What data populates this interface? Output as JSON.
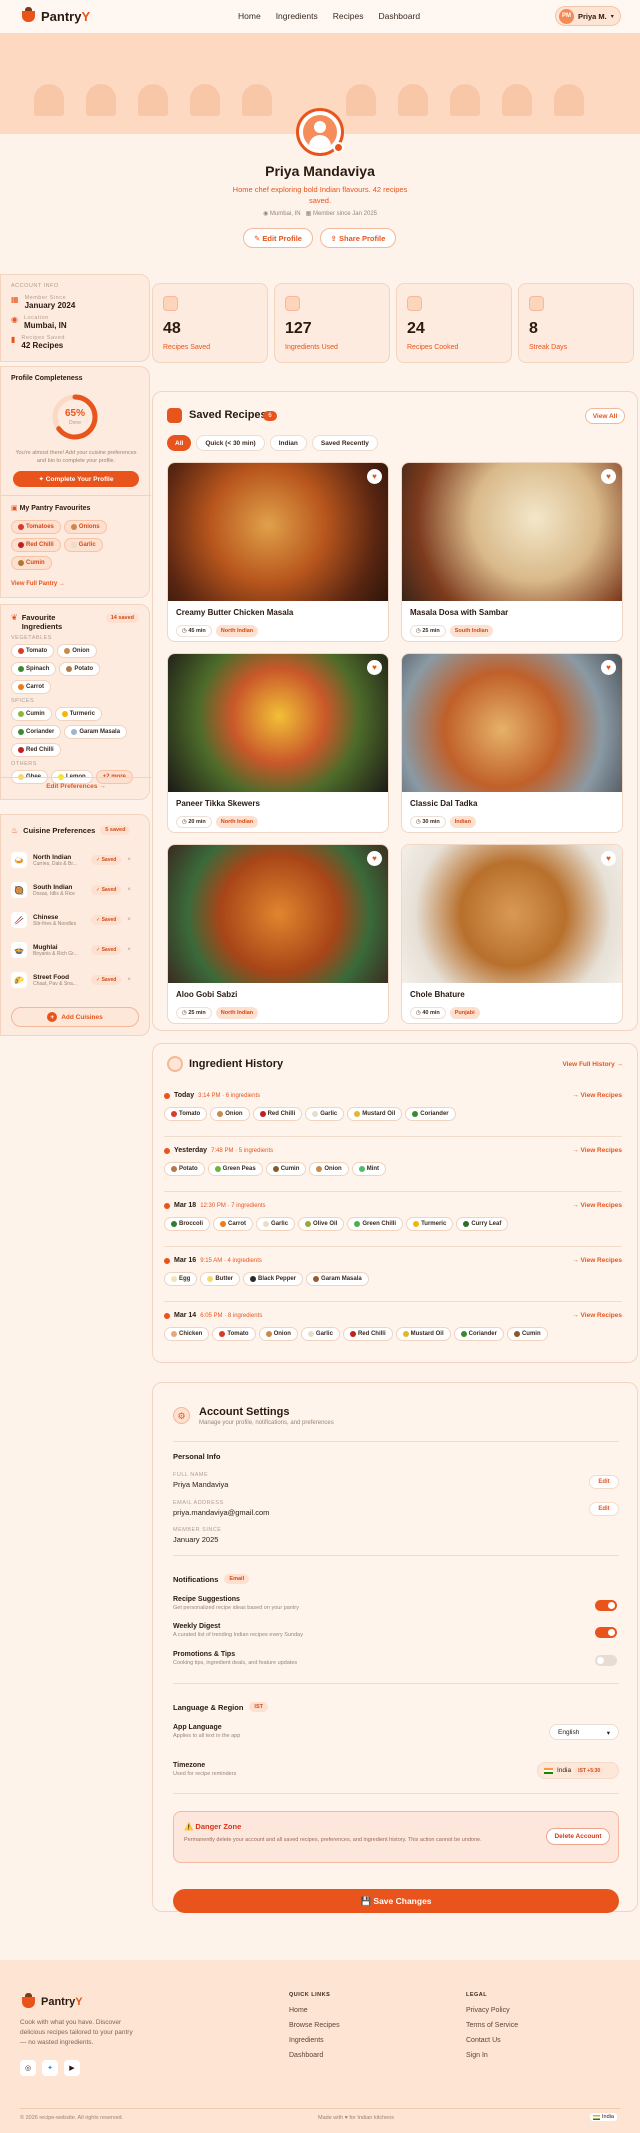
{
  "nav": {
    "brand": "Pantry",
    "brand_accent": "Y",
    "links": [
      "Home",
      "Ingredients",
      "Recipes",
      "Dashboard"
    ],
    "user_initials": "PM",
    "user_name": "Priya M."
  },
  "profile": {
    "name": "Priya Mandaviya",
    "bio": "Home chef exploring bold Indian flavours. 42 recipes saved.",
    "location": "Mumbai, IN",
    "member_since": "Member since Jan 2025",
    "edit": "Edit Profile",
    "share": "Share Profile"
  },
  "account_info": {
    "header": "ACCOUNT INFO",
    "items": [
      {
        "label": "Member Since",
        "value": "January 2024",
        "icon": "calendar-icon"
      },
      {
        "label": "Location",
        "value": "Mumbai, IN",
        "icon": "pin-icon"
      },
      {
        "label": "Recipes Saved",
        "value": "42 Recipes",
        "icon": "bookmark-icon"
      }
    ]
  },
  "completeness": {
    "title": "Profile Completeness",
    "percent": 65,
    "percent_label": "65%",
    "sub": "Done",
    "text": "You're almost there! Add your cuisine preferences and bio to complete your profile.",
    "button": "Complete Your Profile"
  },
  "pantry_favs": {
    "title": "My Pantry Favourites",
    "items": [
      "Tomatoes",
      "Onions",
      "Red Chilli",
      "Garlic",
      "Cumin"
    ],
    "link": "View Full Pantry →"
  },
  "fav_ingredients": {
    "title": "Favourite Ingredients",
    "count": "14 saved",
    "groups": [
      {
        "name": "VEGETABLES",
        "items": [
          "Tomato",
          "Onion",
          "Spinach",
          "Potato",
          "Carrot"
        ]
      },
      {
        "name": "SPICES",
        "items": [
          "Cumin",
          "Turmeric",
          "Coriander",
          "Garam Masala",
          "Red Chilli"
        ]
      },
      {
        "name": "OTHERS",
        "items": [
          "Ghee",
          "Lemon"
        ],
        "more": "+2 more"
      }
    ],
    "link": "Edit Preferences →"
  },
  "cuisines": {
    "title": "Cuisine Preferences",
    "count": "5 saved",
    "items": [
      {
        "name": "North Indian",
        "sub": "Curries, Dals & Br...",
        "status": "✓ Saved"
      },
      {
        "name": "South Indian",
        "sub": "Dosas, Idlis & Rice",
        "status": "✓ Saved"
      },
      {
        "name": "Chinese",
        "sub": "Stir-fries & Noodles",
        "status": "✓ Saved"
      },
      {
        "name": "Mughlai",
        "sub": "Biryanis & Rich Gr...",
        "status": "✓ Saved"
      },
      {
        "name": "Street Food",
        "sub": "Chaat, Pav & Sna...",
        "status": "✓ Saved"
      }
    ],
    "add": "Add Cuisines"
  },
  "stats": [
    {
      "num": "48",
      "label": "Recipes Saved"
    },
    {
      "num": "127",
      "label": "Ingredients Used"
    },
    {
      "num": "24",
      "label": "Recipes Cooked"
    },
    {
      "num": "8",
      "label": "Streak Days"
    }
  ],
  "saved": {
    "title": "Saved Recipes",
    "count": "6",
    "view_all": "View All",
    "filters": [
      "All",
      "Quick (< 30 min)",
      "Indian",
      "Saved Recently"
    ],
    "recipes": [
      {
        "title": "Creamy Butter Chicken Masala",
        "time": "45 min",
        "tag": "North Indian"
      },
      {
        "title": "Masala Dosa with Sambar",
        "time": "25 min",
        "tag": "South Indian"
      },
      {
        "title": "Paneer Tikka Skewers",
        "time": "20 min",
        "tag": "North Indian"
      },
      {
        "title": "Classic Dal Tadka",
        "time": "30 min",
        "tag": "Indian"
      },
      {
        "title": "Aloo Gobi Sabzi",
        "time": "25 min",
        "tag": "North Indian"
      },
      {
        "title": "Chole Bhature",
        "time": "40 min",
        "tag": "Punjabi"
      }
    ]
  },
  "history": {
    "title": "Ingredient History",
    "view_full": "View Full History →",
    "view": "→ View Recipes",
    "days": [
      {
        "day": "Today",
        "meta": "3:14 PM · 6 ingredients",
        "items": [
          "Tomato",
          "Onion",
          "Red Chilli",
          "Garlic",
          "Mustard Oil",
          "Coriander"
        ]
      },
      {
        "day": "Yesterday",
        "meta": "7:48 PM · 5 ingredients",
        "items": [
          "Potato",
          "Green Peas",
          "Cumin",
          "Onion",
          "Mint"
        ]
      },
      {
        "day": "Mar 18",
        "meta": "12:30 PM · 7 ingredients",
        "items": [
          "Broccoli",
          "Carrot",
          "Garlic",
          "Olive Oil",
          "Green Chilli",
          "Turmeric",
          "Curry Leaf"
        ]
      },
      {
        "day": "Mar 16",
        "meta": "9:15 AM · 4 ingredients",
        "items": [
          "Egg",
          "Butter",
          "Black Pepper",
          "Garam Masala"
        ]
      },
      {
        "day": "Mar 14",
        "meta": "6:05 PM · 8 ingredients",
        "items": [
          "Chicken",
          "Tomato",
          "Onion",
          "Garlic",
          "Red Chilli",
          "Mustard Oil",
          "Coriander",
          "Cumin"
        ]
      }
    ]
  },
  "settings": {
    "title": "Account Settings",
    "sub": "Manage your profile, notifications, and preferences",
    "personal": "Personal Info",
    "edit": "Edit",
    "fields": [
      {
        "label": "FULL NAME",
        "value": "Priya Mandaviya"
      },
      {
        "label": "EMAIL ADDRESS",
        "value": "priya.mandaviya@gmail.com"
      },
      {
        "label": "MEMBER SINCE",
        "value": "January 2025"
      }
    ],
    "notifications": "Notifications",
    "notif_badge": "Email",
    "toggles": [
      {
        "title": "Recipe Suggestions",
        "sub": "Get personalized recipe ideas based on your pantry"
      },
      {
        "title": "Weekly Digest",
        "sub": "A curated list of trending Indian recipes every Sunday"
      },
      {
        "title": "Promotions & Tips",
        "sub": "Cooking tips, ingredient deals, and feature updates"
      }
    ],
    "toggle_states": [
      true,
      true,
      false
    ],
    "language": "Language & Region",
    "lang_badge": "IST",
    "app_lang": "App Language",
    "app_lang_sub": "Applies to all text in the app",
    "app_lang_val": "English",
    "tz": "Timezone",
    "tz_sub": "Used for recipe reminders",
    "tz_val": "India",
    "tz_badge": "IST +5:30",
    "danger": "⚠️ Danger Zone",
    "danger_text": "Permanently delete your account and all saved recipes, preferences, and ingredient history. This action cannot be undone.",
    "delete": "Delete Account",
    "save": "💾 Save Changes"
  },
  "footer": {
    "brand": "Pantry",
    "brand_accent": "Y",
    "tagline": "Cook with what you have. Discover delicious recipes tailored to your pantry — no wasted ingredients.",
    "quick": "QUICK LINKS",
    "quick_links": [
      "Home",
      "Browse Recipes",
      "Ingredients",
      "Dashboard"
    ],
    "legal": "LEGAL",
    "legal_links": [
      "Privacy Policy",
      "Terms of Service",
      "Contact Us",
      "Sign In"
    ],
    "copyright": "© 2026 recipe-website. All rights reserved.",
    "made": "Made with ♥ for Indian kitchens",
    "flag": "India"
  }
}
